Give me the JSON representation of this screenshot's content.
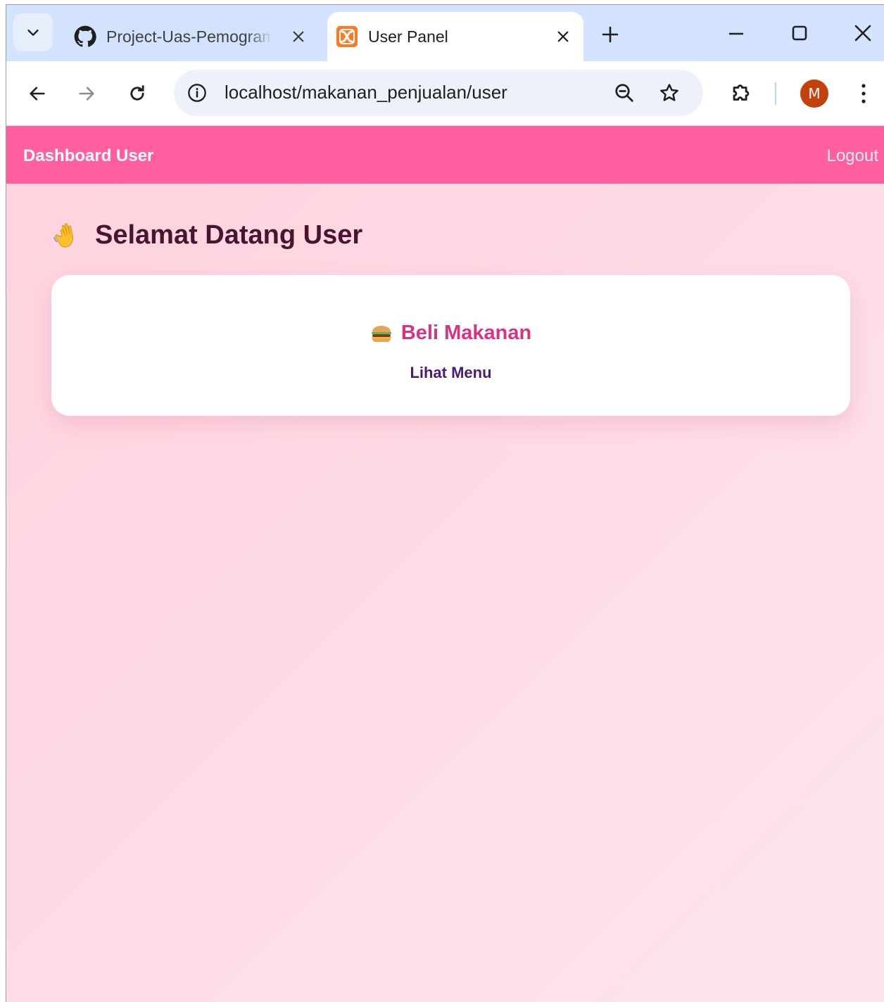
{
  "browser": {
    "tabs": [
      {
        "title": "Project-Uas-Pemograman",
        "favicon": "github-icon",
        "active": false
      },
      {
        "title": "User Panel",
        "favicon": "xampp-icon",
        "active": true
      }
    ],
    "address_bar": {
      "url": "localhost/makanan_penjualan/user"
    },
    "profile_initial": "M",
    "colors": {
      "tabstrip": "#d3e3fd",
      "omnibox": "#edf2fa",
      "avatar": "#c2410c"
    }
  },
  "navbar": {
    "brand": "Dashboard User",
    "logout_label": "Logout",
    "color": "#ff5f9e"
  },
  "main": {
    "welcome_icon": "waving-hand-icon",
    "welcome_text": "Selamat Datang User",
    "card": {
      "icon": "burger-icon",
      "title": "Beli Makanan",
      "link_label": "Lihat Menu"
    },
    "colors": {
      "title": "#4a1430",
      "card_title": "#d63384",
      "link": "#4a1d72"
    }
  }
}
